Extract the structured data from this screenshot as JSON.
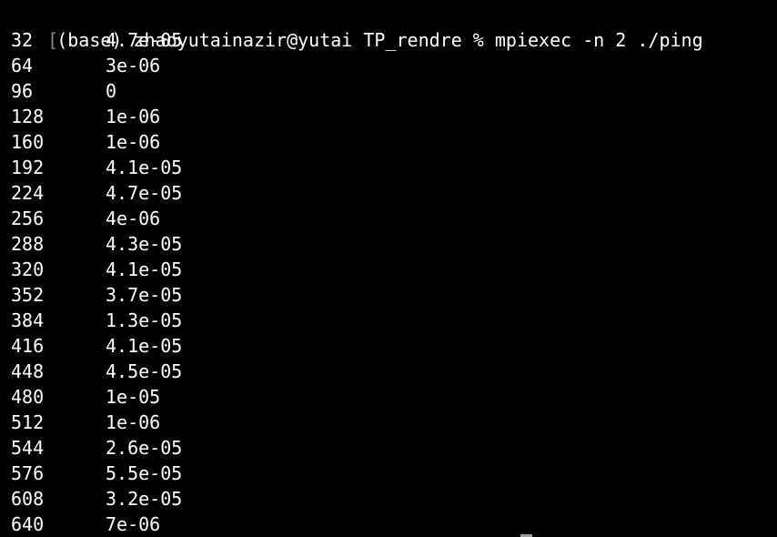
{
  "terminal": {
    "prompt": {
      "bracket": "[",
      "text": "(base) zhaoyutainazir@yutai TP_rendre % mpiexec -n 2 ./ping"
    },
    "rows": [
      {
        "size": "32",
        "time": "4.7e-05"
      },
      {
        "size": "64",
        "time": "3e-06"
      },
      {
        "size": "96",
        "time": "0"
      },
      {
        "size": "128",
        "time": "1e-06"
      },
      {
        "size": "160",
        "time": "1e-06"
      },
      {
        "size": "192",
        "time": "4.1e-05"
      },
      {
        "size": "224",
        "time": "4.7e-05"
      },
      {
        "size": "256",
        "time": "4e-06"
      },
      {
        "size": "288",
        "time": "4.3e-05"
      },
      {
        "size": "320",
        "time": "4.1e-05"
      },
      {
        "size": "352",
        "time": "3.7e-05"
      },
      {
        "size": "384",
        "time": "1.3e-05"
      },
      {
        "size": "416",
        "time": "4.1e-05"
      },
      {
        "size": "448",
        "time": "4.5e-05"
      },
      {
        "size": "480",
        "time": "1e-05"
      },
      {
        "size": "512",
        "time": "1e-06"
      },
      {
        "size": "544",
        "time": "2.6e-05"
      },
      {
        "size": "576",
        "time": "5.5e-05"
      },
      {
        "size": "608",
        "time": "3.2e-05"
      },
      {
        "size": "640",
        "time": "7e-06"
      }
    ]
  },
  "colors": {
    "background": "#000000",
    "text": "#ffffff",
    "bracket": "#8a8a8a"
  }
}
